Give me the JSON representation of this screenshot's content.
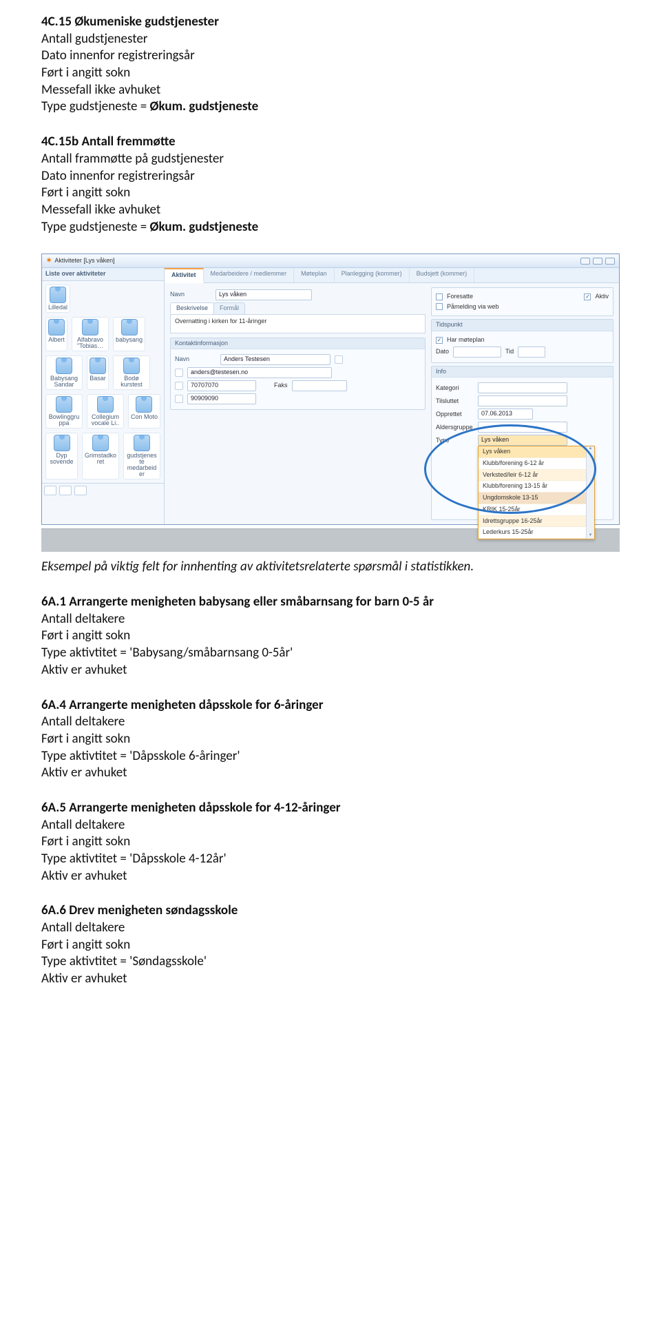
{
  "sections": [
    {
      "title": "4C.15 Økumeniske gudstjenester",
      "lines": [
        "Antall gudstjenester",
        "Dato innenfor registreringsår",
        "Ført i angitt sokn",
        "Messefall ikke avhuket"
      ],
      "final_prefix": "Type gudstjeneste = ",
      "final_bold": "Økum. gudstjeneste"
    },
    {
      "title": "4C.15b Antall fremmøtte",
      "lines": [
        "Antall frammøtte på gudstjenester",
        "Dato innenfor registreringsår",
        "Ført i angitt sokn",
        "Messefall ikke avhuket"
      ],
      "final_prefix": "Type gudstjeneste = ",
      "final_bold": "Økum. gudstjeneste"
    }
  ],
  "caption": "Eksempel på viktig felt for innhenting av aktivitetsrelaterte spørsmål i statistikken.",
  "sections2": [
    {
      "title": "6A.1  Arrangerte menigheten babysang eller småbarnsang for barn 0-5 år",
      "lines": [
        "Antall deltakere",
        "Ført i angitt sokn",
        "Type aktivtitet = 'Babysang/småbarnsang 0-5år'",
        "Aktiv er avhuket"
      ]
    },
    {
      "title": "6A.4  Arrangerte menigheten dåpsskole for 6-åringer",
      "lines": [
        "Antall deltakere",
        "Ført i angitt sokn",
        "Type aktivtitet = 'Dåpsskole 6-åringer'",
        "Aktiv er avhuket"
      ]
    },
    {
      "title": "6A.5  Arrangerte menigheten dåpsskole for 4-12-åringer",
      "lines": [
        "Antall deltakere",
        "Ført i angitt sokn",
        "Type aktivtitet = 'Dåpsskole 4-12år'",
        "Aktiv er avhuket"
      ]
    },
    {
      "title": "6A.6  Drev menigheten søndagsskole",
      "lines": [
        "Antall deltakere",
        "Ført i angitt sokn",
        "Type aktivtitet = 'Søndagsskole'",
        "Aktiv er avhuket"
      ]
    }
  ],
  "app": {
    "title": "Aktiviteter [Lys våken]",
    "left_header": "Liste over aktiviteter",
    "items": [
      [
        "Lilledal"
      ],
      [
        "Albert",
        "Alfabravo \"Tobias…",
        "babysang"
      ],
      [
        "Babysang Sandar",
        "Basar",
        "Bodø kurstest"
      ],
      [
        "Bowlinggruppa",
        "Collegium vocale Li..",
        "Con Moto"
      ],
      [
        "Dyp sovende",
        "Grimstadkoret",
        "gudstjeneste medarbeider"
      ]
    ],
    "tabs": [
      "Aktivitet",
      "Medarbeidere / medlemmer",
      "Møteplan",
      "Planlegging (kommer)",
      "Budsjett (kommer)"
    ],
    "form": {
      "navn_label": "Navn",
      "navn_value": "Lys våken",
      "sub_tabs": [
        "Beskrivelse",
        "Formål"
      ],
      "beskrivelse": "Overnatting i kirken for 11-åringer",
      "kontakt_header": "Kontaktinformasjon",
      "kontakt_navn": "Anders Testesen",
      "kontakt_email": "anders@testesen.no",
      "kontakt_tlf": "70707070",
      "kontakt_mob": "90909090",
      "faks_label": "Faks",
      "right_box1": {
        "foresatte": "Foresatte",
        "aktiv": "Aktiv",
        "pamelding": "Påmelding via web"
      },
      "tidspunkt_header": "Tidspunkt",
      "har_moteplan": "Har møteplan",
      "dato": "Dato",
      "tid": "Tid",
      "info_header": "Info",
      "kategori": "Kategori",
      "tilsluttet": "Tilsluttet",
      "opprettet_label": "Opprettet",
      "opprettet_val": "07.06.2013",
      "aldersgruppe": "Aldersgruppe",
      "type_label": "Type",
      "type_value": "Lys våken"
    },
    "dropdown": [
      "Lys våken",
      "Klubb/forening 6-12 år",
      "Verksted/leir 6-12 år",
      "Klubb/forening 13-15 år",
      "Ungdomskole 13-15",
      "KRIK 15-25år",
      "Idrettsgruppe 16-25år",
      "Lederkurs 15-25år"
    ]
  }
}
